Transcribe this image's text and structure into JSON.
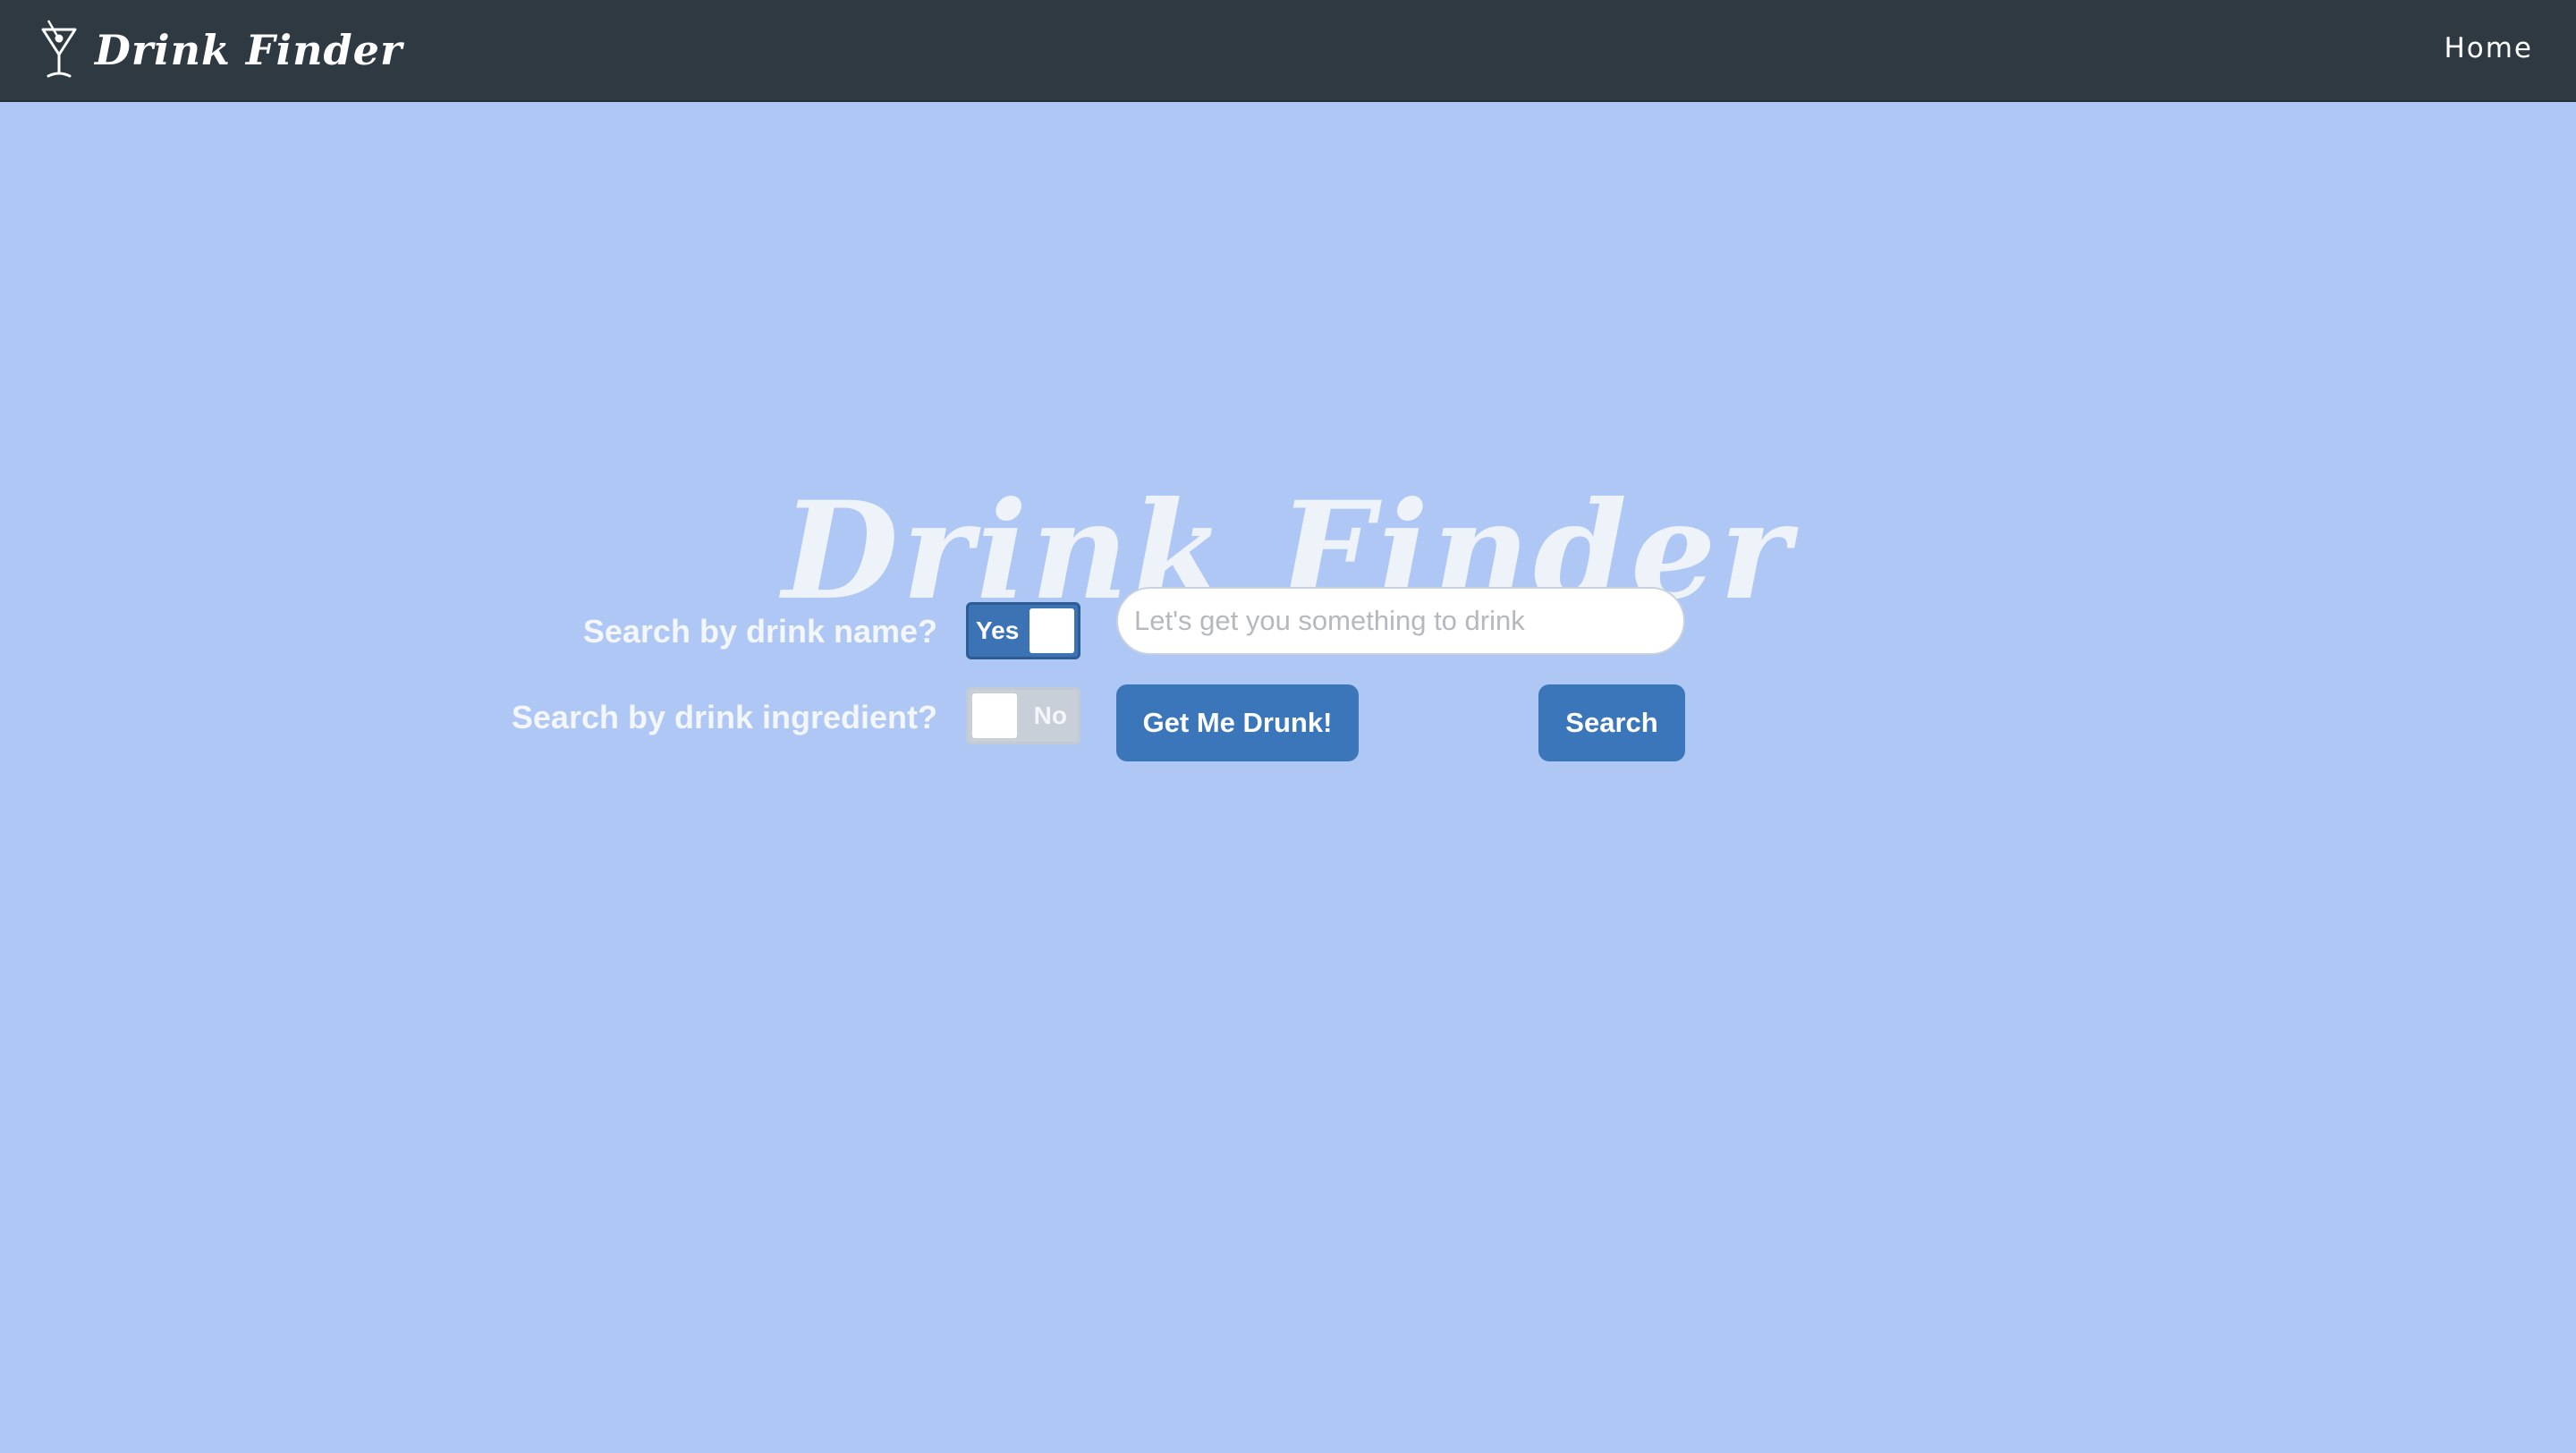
{
  "navbar": {
    "brand_text": "Drink Finder",
    "brand_icon": "martini-glass-icon",
    "home_link": "Home"
  },
  "hero": {
    "title": "Drink Finder"
  },
  "search": {
    "by_name_label": "Search by drink name?",
    "by_name_toggle": {
      "text": "Yes",
      "state": "on"
    },
    "by_ingredient_label": "Search by drink ingredient?",
    "by_ingredient_toggle": {
      "text": "No",
      "state": "off"
    },
    "input_placeholder": "Let's get you something to drink",
    "input_value": "",
    "random_button": "Get Me Drunk!",
    "search_button": "Search"
  },
  "colors": {
    "background": "#afc7f4",
    "navbar": "#2e3941",
    "accent": "#3a76b9",
    "toggle_off": "#c9cfd8"
  }
}
